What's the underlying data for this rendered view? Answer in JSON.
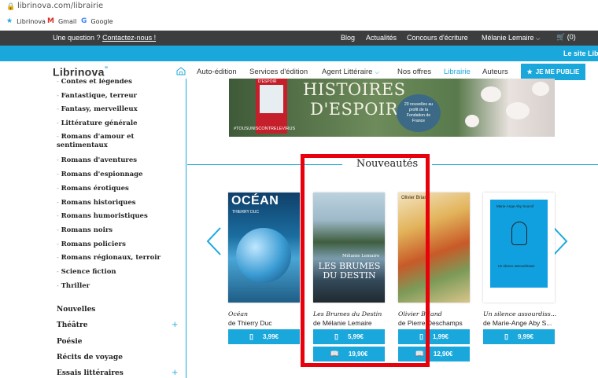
{
  "browser": {
    "url": "librinova.com/librairie",
    "bookmarks": [
      {
        "label": "Librinova",
        "icon": "star-icon"
      },
      {
        "label": "Gmail",
        "icon": "gmail-icon"
      },
      {
        "label": "Google",
        "icon": "google-icon"
      }
    ]
  },
  "topbar": {
    "question": "Une question ?",
    "contact_link": "Contactez-nous !",
    "links": [
      "Blog",
      "Actualités",
      "Concours d'écriture"
    ],
    "user": "Mélanie Lemaire",
    "cart_count": "(0)"
  },
  "banner": {
    "text": "Le site Lib"
  },
  "nav": {
    "logo": "Librinova",
    "items": [
      "Auto-édition",
      "Services d'édition",
      "Agent Littéraire",
      "Nos offres",
      "Librairie",
      "Auteurs"
    ],
    "active": "Librairie",
    "cta": "JE ME PUBLIE"
  },
  "sidebar": {
    "subcategories": [
      "Contes et légendes",
      "Fantastique, terreur",
      "Fantasy, merveilleux",
      "Littérature générale",
      "Romans d'amour et sentimentaux",
      "Romans d'aventures",
      "Romans d'espionnage",
      "Romans érotiques",
      "Romans historiques",
      "Romans humoristiques",
      "Romans noirs",
      "Romans policiers",
      "Romans régionaux, terroir",
      "Science fiction",
      "Thriller"
    ],
    "categories": [
      {
        "label": "Nouvelles",
        "expandable": false
      },
      {
        "label": "Théâtre",
        "expandable": true
      },
      {
        "label": "Poésie",
        "expandable": false
      },
      {
        "label": "Récits de voyage",
        "expandable": false
      },
      {
        "label": "Essais littéraires",
        "expandable": true
      }
    ],
    "plus": "+"
  },
  "hero": {
    "top_label": "D'ESPOIR",
    "title": "HISTOIRES D'ESPOIR",
    "circle_text": "20 nouvelles au profit de la Fondation de France",
    "hashtag": "#TOUSUNISCONTRELEVIRUS"
  },
  "section": {
    "title": "Nouveautés"
  },
  "books": [
    {
      "title": "Océan",
      "author": "de Thierry Duc",
      "cover_title": "OCÉAN",
      "cover_author": "THIERRY DUC",
      "prices": [
        {
          "icon": "tablet-icon",
          "price": "3,99€"
        }
      ]
    },
    {
      "title": "Les Brumes du Destin",
      "author": "de Mélanie Lemaire",
      "cover_title": "LES BRUMES DU DESTIN",
      "cover_author": "Mélanie Lemaire",
      "prices": [
        {
          "icon": "tablet-icon",
          "price": "5,99€"
        },
        {
          "icon": "book-icon",
          "price": "19,90€"
        }
      ]
    },
    {
      "title": "Olivier Briand",
      "author": "de Pierre Deschamps",
      "cover_title": "Olivier Briand",
      "prices": [
        {
          "icon": "tablet-icon",
          "price": "1,99€"
        },
        {
          "icon": "book-icon",
          "price": "12,90€"
        }
      ]
    },
    {
      "title": "Un silence assourdiss...",
      "author": "de Marie-Ange Aby S...",
      "cover_title": "Marie-Ange Aby Sourvif",
      "cover_subtitle": "Un silence assourdissant",
      "prices": [
        {
          "icon": "tablet-icon",
          "price": "9,99€"
        }
      ]
    }
  ],
  "colors": {
    "accent": "#1aa8dc",
    "dark_bar": "#3c3d3f",
    "highlight": "#e8000b"
  }
}
